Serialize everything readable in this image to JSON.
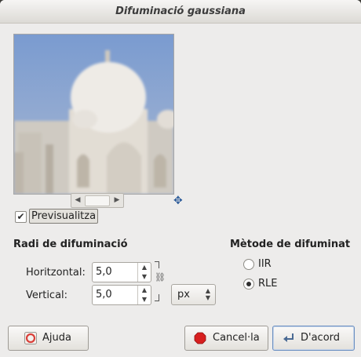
{
  "window": {
    "title": "Difuminació gaussiana"
  },
  "preview": {
    "checkbox_checked": true,
    "label": "Previsualitza"
  },
  "radius": {
    "title": "Radi de difuminació",
    "horizontal_label": "Horitzontal:",
    "horizontal_value": "5,0",
    "vertical_label": "Vertical:",
    "vertical_value": "5,0",
    "unit": "px"
  },
  "method": {
    "title": "Mètode de difuminat",
    "options": [
      {
        "label": "IIR",
        "selected": false
      },
      {
        "label": "RLE",
        "selected": true
      }
    ]
  },
  "buttons": {
    "help": "Ajuda",
    "cancel": "Cancel·la",
    "ok": "D'acord"
  },
  "icons": {
    "checkbox_mark": "✔",
    "nav": "✥",
    "chain": "⛓"
  }
}
